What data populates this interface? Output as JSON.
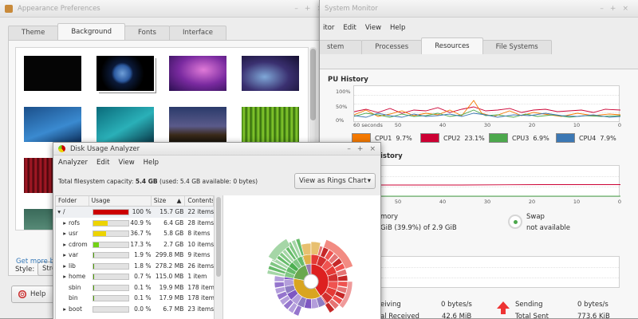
{
  "appearance": {
    "title": "Appearance Preferences",
    "tabs": [
      "Theme",
      "Background",
      "Fonts",
      "Interface"
    ],
    "style_label": "Style:",
    "style_value": "Stret",
    "more_link": "Get more bac",
    "help_label": "Help"
  },
  "sysmon": {
    "title": "System Monitor",
    "menu": [
      "itor",
      "Edit",
      "View",
      "Help"
    ],
    "tabs": [
      "stem",
      "Processes",
      "Resources",
      "File Systems"
    ],
    "cpu_history": "PU History",
    "pct_labels": [
      "100%",
      "50%",
      "0%"
    ],
    "x_labels": [
      "60 seconds",
      "50",
      "40",
      "30",
      "20",
      "10",
      "0"
    ],
    "legend": [
      {
        "label": "CPU1",
        "value": "9.7%",
        "color": "#f57900"
      },
      {
        "label": "CPU2",
        "value": "23.1%",
        "color": "#cc0033"
      },
      {
        "label": "CPU3",
        "value": "6.9%",
        "color": "#4ca84c"
      },
      {
        "label": "CPU4",
        "value": "7.9%",
        "color": "#3c78b4"
      }
    ],
    "memory_history": "istory",
    "x_labels2": [
      "50",
      "40",
      "30",
      "20",
      "10",
      "0"
    ],
    "memory_label": "mory",
    "memory_value": "GiB (39.9%) of 2.9 GiB",
    "swap_label": "Swap",
    "swap_value": "not available",
    "receiving_label": "eiving",
    "receiving_value": "0 bytes/s",
    "total_received_label": "al Received",
    "total_received_value": "42.6 MiB",
    "sending_label": "Sending",
    "sending_value": "0 bytes/s",
    "total_sent_label": "Total Sent",
    "total_sent_value": "773.6 KiB"
  },
  "disk": {
    "title": "Disk Usage Analyzer",
    "menu": [
      "Analyzer",
      "Edit",
      "View",
      "Help"
    ],
    "capacity": "Total filesystem capacity: 5.4 GB (used: 5.4 GB available: 0 bytes)",
    "capacity_bold": "5.4 GB",
    "view_button": "View as Rings Chart",
    "columns": [
      "Folder",
      "Usage",
      "Size",
      "Contents"
    ],
    "rows": [
      {
        "arrow": "▾",
        "folder": "/",
        "pct": "100 %",
        "usage": 1.0,
        "color": "#cc0000",
        "size": "15.7 GB",
        "contents": "22 items"
      },
      {
        "arrow": "▸",
        "folder": "rofs",
        "pct": "40.9 %",
        "usage": 0.409,
        "color": "#edd400",
        "size": "6.4 GB",
        "contents": "28 items"
      },
      {
        "arrow": "▸",
        "folder": "usr",
        "pct": "36.7 %",
        "usage": 0.367,
        "color": "#edd400",
        "size": "5.8 GB",
        "contents": "8 items"
      },
      {
        "arrow": "▸",
        "folder": "cdrom",
        "pct": "17.3 %",
        "usage": 0.173,
        "color": "#73d216",
        "size": "2.7 GB",
        "contents": "10 items"
      },
      {
        "arrow": "▸",
        "folder": "var",
        "pct": "1.9 %",
        "usage": 0.019,
        "color": "#4e9a06",
        "size": "299.8 MB",
        "contents": "9 items"
      },
      {
        "arrow": "▸",
        "folder": "lib",
        "pct": "1.8 %",
        "usage": 0.018,
        "color": "#4e9a06",
        "size": "278.2 MB",
        "contents": "26 items"
      },
      {
        "arrow": "▸",
        "folder": "home",
        "pct": "0.7 %",
        "usage": 0.007,
        "color": "#4e9a06",
        "size": "115.0 MB",
        "contents": "1 item"
      },
      {
        "arrow": "",
        "folder": "sbin",
        "pct": "0.1 %",
        "usage": 0.001,
        "color": "#4e9a06",
        "size": "19.9 MB",
        "contents": "178 items"
      },
      {
        "arrow": "",
        "folder": "bin",
        "pct": "0.1 %",
        "usage": 0.001,
        "color": "#4e9a06",
        "size": "17.9 MB",
        "contents": "178 items"
      },
      {
        "arrow": "▸",
        "folder": "boot",
        "pct": "0.0 %",
        "usage": 0.0,
        "color": "#4e9a06",
        "size": "6.7 MB",
        "contents": "23 items"
      }
    ]
  }
}
